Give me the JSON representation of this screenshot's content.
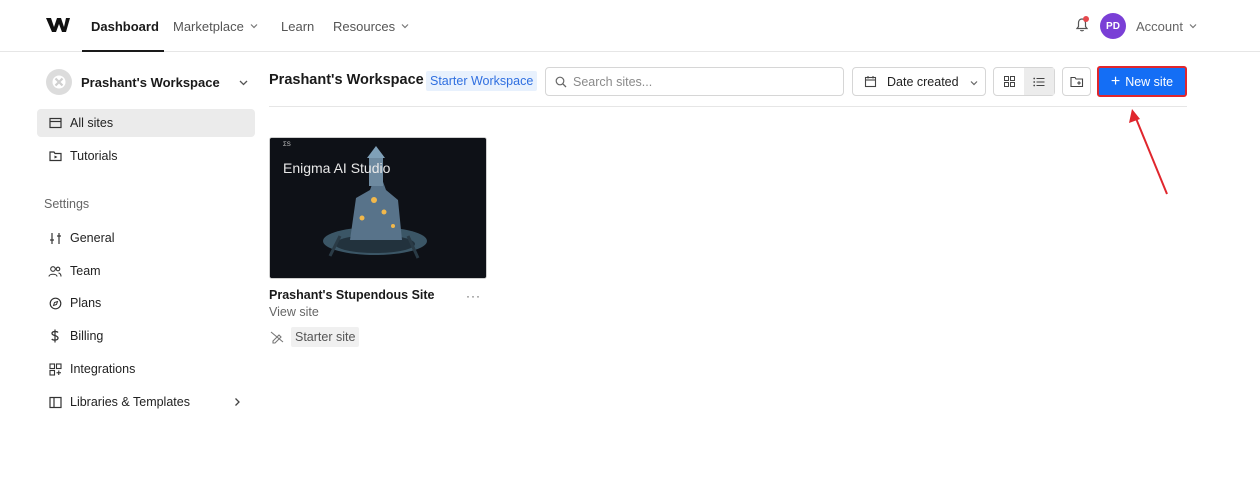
{
  "topnav": {
    "items": [
      {
        "label": "Dashboard",
        "active": true
      },
      {
        "label": "Marketplace",
        "has_dropdown": true
      },
      {
        "label": "Learn"
      },
      {
        "label": "Resources",
        "has_dropdown": true
      }
    ],
    "avatar_initials": "PD",
    "account_label": "Account",
    "notification_icon": "bell-icon"
  },
  "sidebar": {
    "workspace_name": "Prashant's Workspace",
    "nav": [
      {
        "label": "All sites",
        "icon": "browser-window-icon",
        "active": true
      },
      {
        "label": "Tutorials",
        "icon": "video-folder-icon"
      }
    ],
    "settings_heading": "Settings",
    "settings": [
      {
        "label": "General",
        "icon": "sliders-icon"
      },
      {
        "label": "Team",
        "icon": "users-icon"
      },
      {
        "label": "Plans",
        "icon": "compass-icon"
      },
      {
        "label": "Billing",
        "icon": "dollar-icon"
      },
      {
        "label": "Integrations",
        "icon": "apps-icon"
      },
      {
        "label": "Libraries & Templates",
        "icon": "book-icon",
        "has_submenu": true
      }
    ]
  },
  "main": {
    "title": "Prashant's Workspace",
    "plan_badge": "Starter Workspace",
    "search_placeholder": "Search sites...",
    "sort_label": "Date created",
    "new_site_label": "New site",
    "sites": [
      {
        "name": "Prashant's Stupendous Site",
        "link": "View site",
        "tag": "Starter site",
        "thumbnail_title": "Enigma AI Studio"
      }
    ]
  },
  "colors": {
    "accent": "#146ef5",
    "highlight_border": "#e0262d",
    "avatar": "#7a3fd6",
    "badge_bg": "#e8f1fd",
    "badge_text": "#2f6fe0",
    "annotation_arrow": "#e0262d"
  }
}
